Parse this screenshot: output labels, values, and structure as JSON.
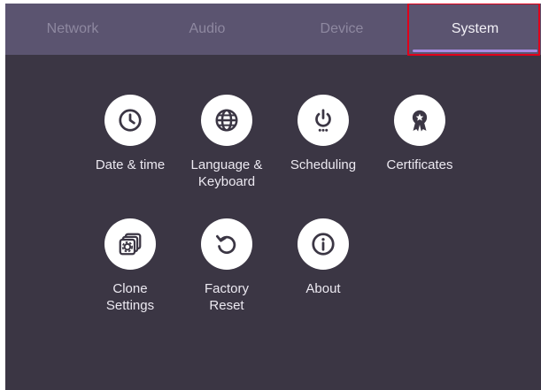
{
  "tabs": [
    {
      "label": "Network"
    },
    {
      "label": "Audio"
    },
    {
      "label": "Device"
    },
    {
      "label": "System"
    }
  ],
  "active_tab": "System",
  "tiles": [
    {
      "label": "Date & time",
      "icon": "clock-icon"
    },
    {
      "label": "Language &\nKeyboard",
      "icon": "globe-icon"
    },
    {
      "label": "Scheduling",
      "icon": "power-schedule-icon"
    },
    {
      "label": "Certificates",
      "icon": "certificate-badge-icon"
    },
    {
      "label": "Clone\nSettings",
      "icon": "clone-settings-icon"
    },
    {
      "label": "Factory\nReset",
      "icon": "reset-icon"
    },
    {
      "label": "About",
      "icon": "info-icon"
    }
  ],
  "colors": {
    "background": "#3b3644",
    "tab_bar": "#5b5470",
    "tab_inactive_text": "#8e88a0",
    "tab_active_text": "#f2f0f6",
    "tab_underline": "#a98be2",
    "highlight_box": "#e0001b",
    "icon_circle": "#ffffff"
  }
}
